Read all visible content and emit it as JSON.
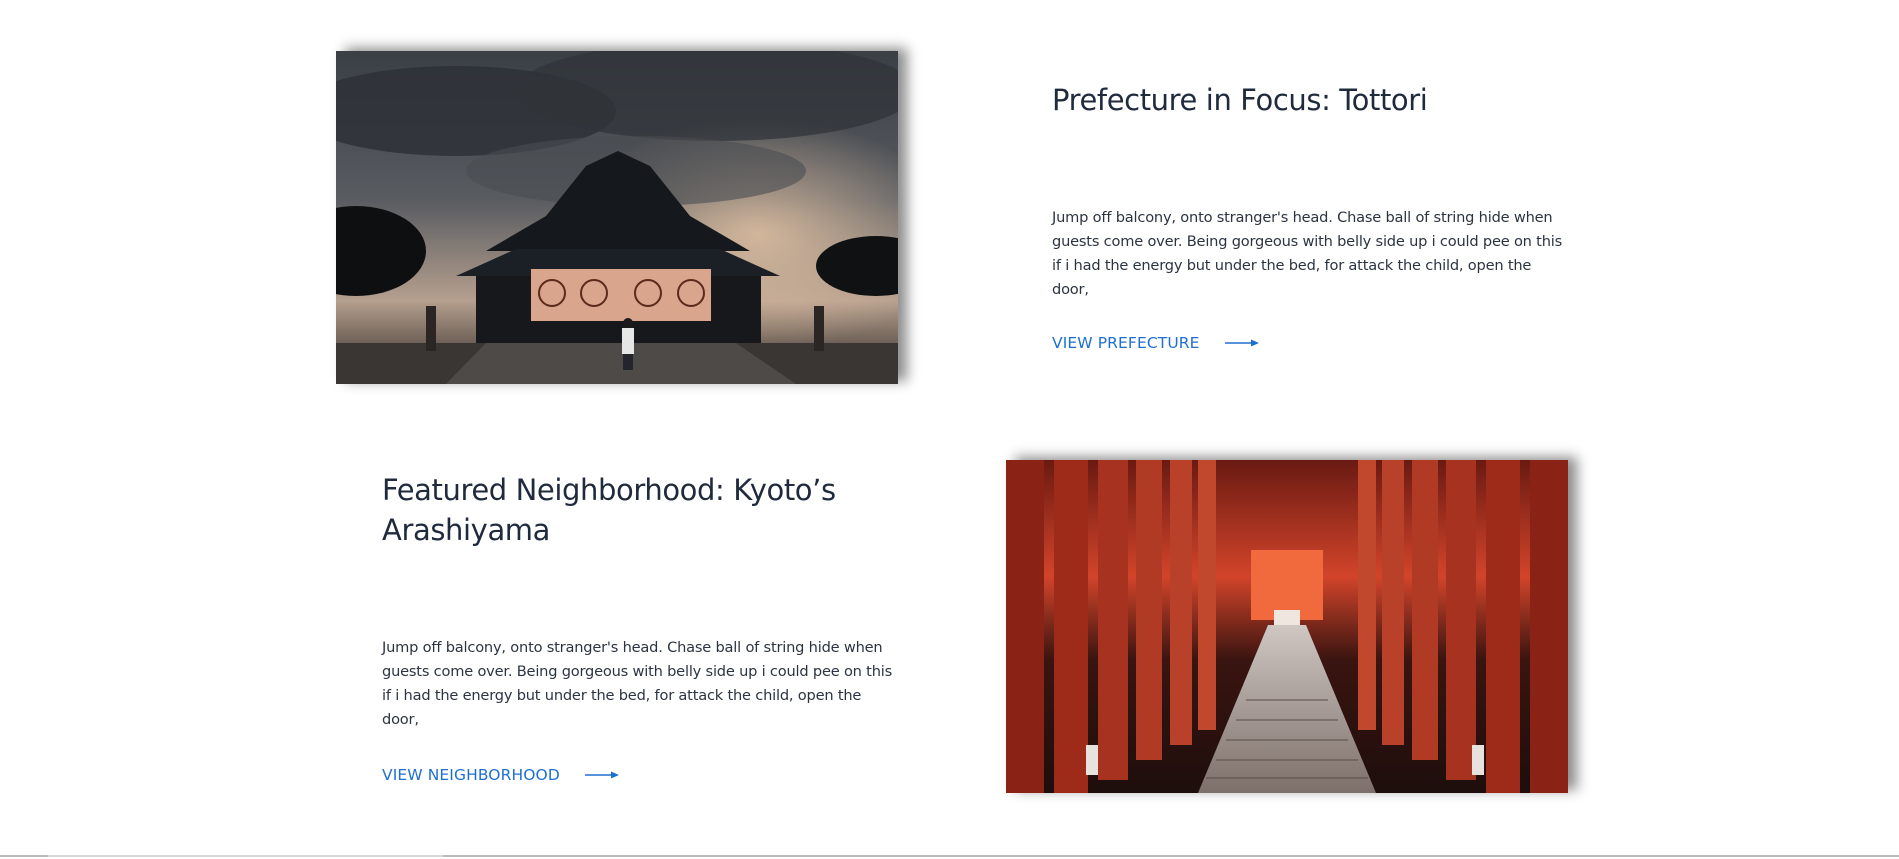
{
  "features": [
    {
      "title": "Prefecture in Focus: Tottori",
      "body": "Jump off balcony, onto stranger's head. Chase ball of string hide when guests come over. Being gorgeous with belly side up i could pee on this if i had the energy but under the bed, for attack the child, open the door,",
      "link_label": "VIEW PREFECTURE"
    },
    {
      "title": "Featured Neighborhood: Kyoto’s Arashiyama",
      "body": "Jump off balcony, onto stranger's head. Chase ball of string hide when guests come over. Being gorgeous with belly side up i could pee on this if i had the energy but under the bed, for attack the child, open the door,",
      "link_label": "VIEW NEIGHBORHOOD"
    }
  ],
  "icons": {
    "link_arrow": "arrow-right-icon"
  },
  "colors": {
    "link": "#1f6fd1",
    "heading": "#1f2a3d",
    "text": "#2c3442"
  }
}
